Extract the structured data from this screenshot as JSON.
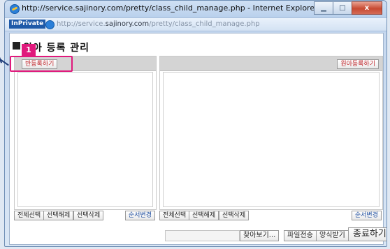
{
  "window": {
    "title": "http://service.sajinory.com/pretty/class_child_manage.php - Internet Explorer - [InPrivate]",
    "inprivate_label": "InPrivate",
    "url_prefix": "http://service.",
    "url_domain": "sajinory.com",
    "url_path": "/pretty/class_child_manage.php"
  },
  "page": {
    "title": "원아 등록 관리"
  },
  "left_panel": {
    "register_class_label": "반등록하기",
    "toolbar": {
      "select_all": "전체선택",
      "deselect": "선택해제",
      "delete_selected": "선택삭제",
      "reorder": "순서변경"
    }
  },
  "right_panel": {
    "register_child_label": "원아등록하기",
    "toolbar": {
      "select_all": "전체선택",
      "deselect": "선택해제",
      "delete_selected": "선택삭제",
      "reorder": "순서변경"
    }
  },
  "bottom": {
    "browse_label": "찾아보기...",
    "send_file_label": "파일전송",
    "get_form_label": "양식받기",
    "finish_label": "종료하기"
  },
  "annotation": {
    "step_number": "1"
  },
  "colors": {
    "highlight": "#e0197c",
    "red_text": "#c0272d",
    "blue_text": "#1f4fa0"
  },
  "icons": [
    "ie-logo-icon",
    "minimize-icon",
    "maximize-icon",
    "close-icon"
  ]
}
